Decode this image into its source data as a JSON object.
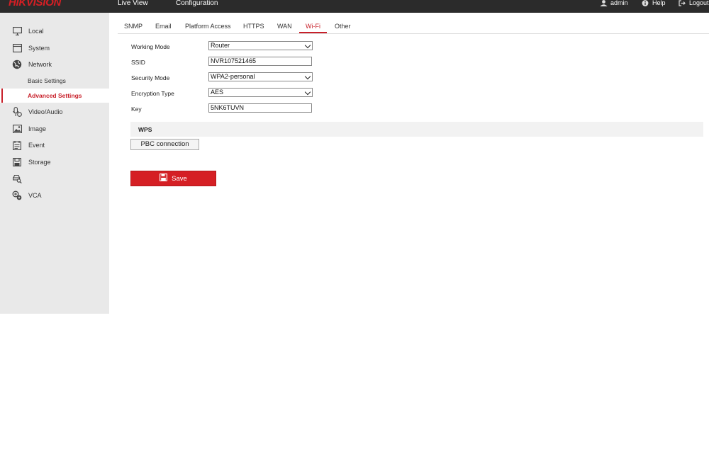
{
  "header": {
    "logo": "HIKVISION",
    "nav": {
      "live_view": "Live View",
      "configuration": "Configuration"
    },
    "user": "admin",
    "help": "Help",
    "logout": "Logout"
  },
  "sidebar": {
    "items": [
      {
        "label": "Local",
        "icon": "monitor-icon"
      },
      {
        "label": "System",
        "icon": "system-icon"
      },
      {
        "label": "Network",
        "icon": "globe-icon"
      },
      {
        "label": "Basic Settings"
      },
      {
        "label": "Advanced Settings"
      },
      {
        "label": "Video/Audio",
        "icon": "mic-icon"
      },
      {
        "label": "Image",
        "icon": "image-icon"
      },
      {
        "label": "Event",
        "icon": "event-icon"
      },
      {
        "label": "Storage",
        "icon": "storage-icon"
      },
      {
        "label": "",
        "icon": "search-vehicle-icon"
      },
      {
        "label": "VCA",
        "icon": "vca-icon"
      }
    ],
    "active": "Advanced Settings"
  },
  "tabs": [
    {
      "label": "SNMP"
    },
    {
      "label": "Email"
    },
    {
      "label": "Platform Access"
    },
    {
      "label": "HTTPS"
    },
    {
      "label": "WAN"
    },
    {
      "label": "Wi-Fi"
    },
    {
      "label": "Other"
    }
  ],
  "active_tab": "Wi-Fi",
  "form": {
    "working_mode": {
      "label": "Working Mode",
      "value": "Router"
    },
    "ssid": {
      "label": "SSID",
      "value": "NVR107521465"
    },
    "security_mode": {
      "label": "Security Mode",
      "value": "WPA2-personal"
    },
    "encryption_type": {
      "label": "Encryption Type",
      "value": "AES"
    },
    "key": {
      "label": "Key",
      "value": "5NK6TUVN"
    }
  },
  "wps": {
    "title": "WPS",
    "pbc_label": "PBC connection"
  },
  "save_label": "Save",
  "colors": {
    "accent": "#d51f24",
    "header_bg": "#2b2b2b",
    "sidebar_bg": "#e9e9e9"
  }
}
